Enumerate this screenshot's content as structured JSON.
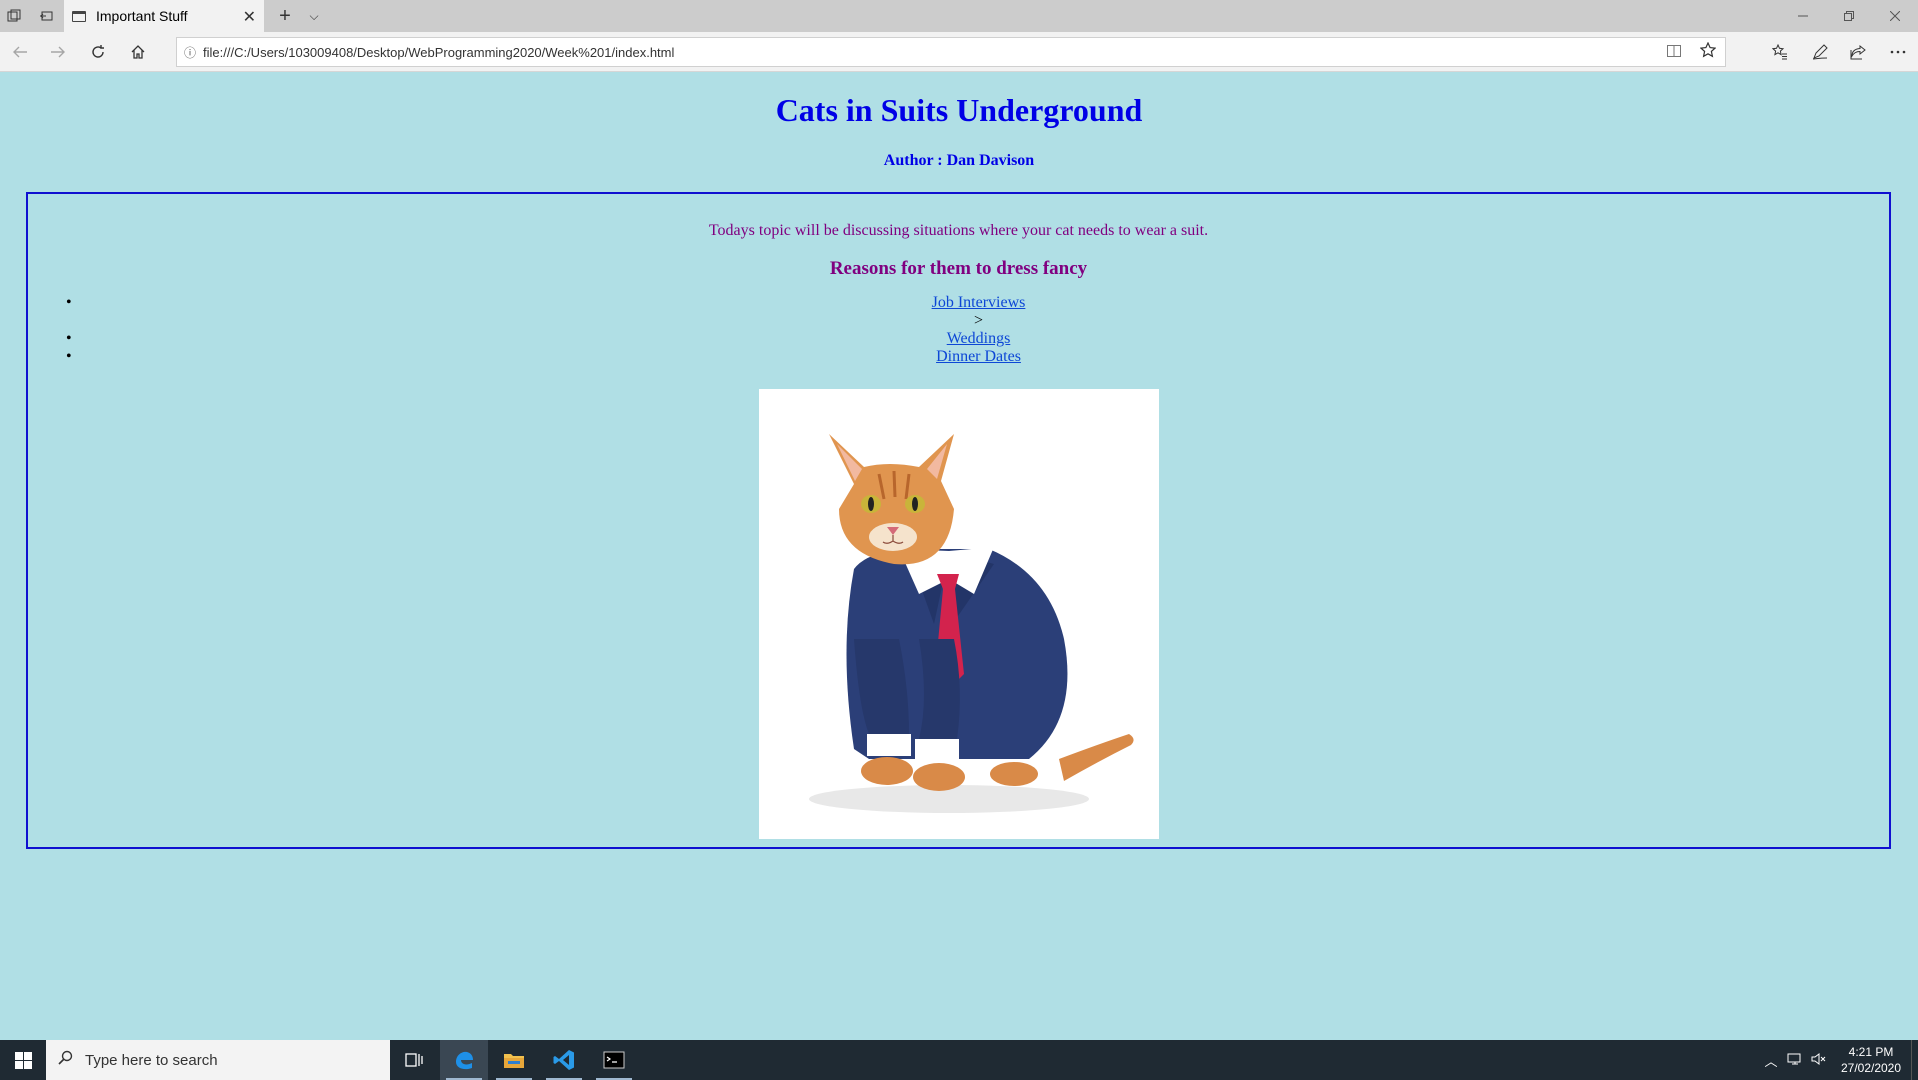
{
  "browser": {
    "tab_title": "Important Stuff",
    "tab_close": "✕",
    "new_tab": "+",
    "tab_list": "⌵",
    "address": "file:///C:/Users/103009408/Desktop/WebProgramming2020/Week%201/index.html",
    "info_icon": "ⓘ"
  },
  "page": {
    "title": "Cats in Suits Underground",
    "author": "Author : Dan Davison",
    "intro": "Todays topic will be discussing situations where your cat needs to wear a suit.",
    "subheading": "Reasons for them to dress fancy",
    "reasons": [
      {
        "label": "Job Interviews"
      },
      {
        "label": "Weddings"
      },
      {
        "label": "Dinner Dates"
      }
    ],
    "stray_text": ">"
  },
  "taskbar": {
    "search_placeholder": "Type here to search",
    "time": "4:21 PM",
    "date": "27/02/2020"
  },
  "colors": {
    "page_background": "#b0dfe5",
    "heading": "#0000e6",
    "purple_text": "#800080",
    "link": "#0d47d6",
    "box_border": "#1010d0"
  }
}
